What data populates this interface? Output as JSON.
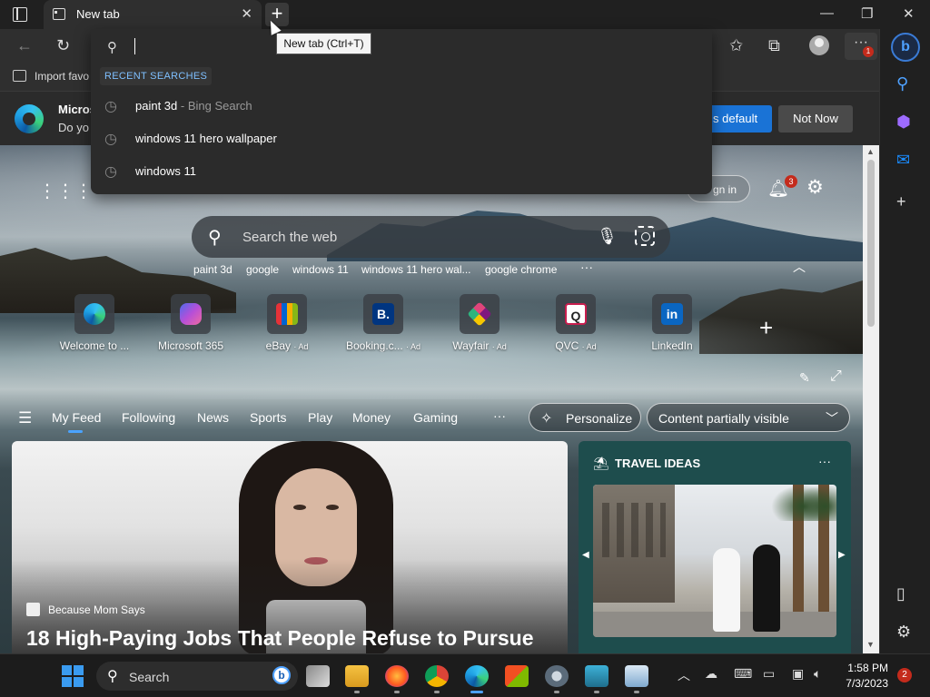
{
  "window": {
    "tab_title": "New tab",
    "new_tab_tooltip": "New tab (Ctrl+T)"
  },
  "favorites_bar": {
    "import_label": "Import favo"
  },
  "banner": {
    "title": "Micros",
    "text": "Do yo",
    "set_default_label": "s default",
    "not_now_label": "Not Now"
  },
  "address_dropdown": {
    "recent_label": "RECENT SEARCHES",
    "items": [
      {
        "text": "paint 3d",
        "source": " - Bing Search"
      },
      {
        "text": "windows 11 hero wallpaper",
        "source": ""
      },
      {
        "text": "windows 11",
        "source": ""
      }
    ]
  },
  "toolbar": {
    "more_badge": "1"
  },
  "ntp": {
    "signin_label": "gn in",
    "notification_count": "3",
    "search_placeholder": "Search the web",
    "chips": [
      "paint 3d",
      "google",
      "windows 11",
      "windows 11 hero wal...",
      "google chrome"
    ],
    "chips_more": "···",
    "tiles": [
      {
        "label": "Welcome to ...",
        "ad": "",
        "glyph": "",
        "color": "#1a73d6"
      },
      {
        "label": "Microsoft 365",
        "ad": "",
        "glyph": "",
        "color": "#7a4bd1"
      },
      {
        "label": "eBay",
        "ad": "· Ad",
        "glyph": "",
        "color": "#e53238"
      },
      {
        "label": "Booking.c...",
        "ad": "· Ad",
        "glyph": "B.",
        "color": "#003580"
      },
      {
        "label": "Wayfair",
        "ad": "· Ad",
        "glyph": "",
        "color": "#7f187f"
      },
      {
        "label": "QVC",
        "ad": "· Ad",
        "glyph": "Q",
        "color": "#ffffff"
      },
      {
        "label": "LinkedIn",
        "ad": "",
        "glyph": "in",
        "color": "#0a66c2"
      }
    ],
    "feed_tabs": [
      "My Feed",
      "Following",
      "News",
      "Sports",
      "Play",
      "Money",
      "Gaming"
    ],
    "feed_more": "···",
    "personalize_label": "Personalize",
    "content_visibility": "Content partially visible"
  },
  "hero_card": {
    "source": "Because Mom Says",
    "title": "18 High-Paying Jobs That People Refuse to Pursue"
  },
  "travel_card": {
    "title": "TRAVEL IDEAS",
    "more": "···"
  },
  "taskbar": {
    "search_label": "Search",
    "bing_glyph": "b",
    "time": "1:58 PM",
    "date": "7/3/2023",
    "notification_count": "2"
  },
  "sidebar": {
    "bing_glyph": "b"
  }
}
